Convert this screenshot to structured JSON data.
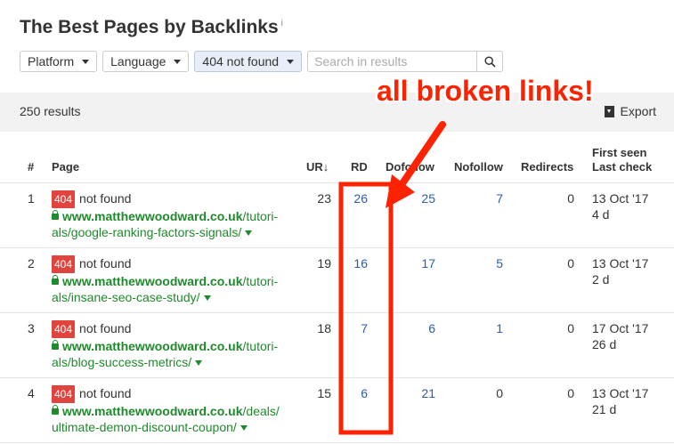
{
  "header": {
    "title": "The Best Pages by Backlinks",
    "info_mark": "i",
    "filters": {
      "platform": "Platform",
      "language": "Language",
      "status": "404 not found"
    },
    "search_placeholder": "Search in results"
  },
  "bar": {
    "results": "250 results",
    "export": "Export"
  },
  "columns": {
    "idx": "#",
    "page": "Page",
    "ur": "UR",
    "ur_sort": "↓",
    "rd": "RD",
    "dofollow": "Dofollow",
    "nofollow": "Nofollow",
    "redirects": "Redirects",
    "first_seen": "First seen",
    "last_check": "Last check"
  },
  "rows": [
    {
      "idx": "1",
      "badge": "404",
      "status": "not found",
      "domain": "www.matthewwoodward.co.uk",
      "path1": "/tutori-",
      "path2": "als/google-ranking-factors-signals/",
      "ur": "23",
      "rd": "26",
      "dofollow": "25",
      "nofollow": "7",
      "redirects": "0",
      "first_seen": "13 Oct '17",
      "last_check": "4 d"
    },
    {
      "idx": "2",
      "badge": "404",
      "status": "not found",
      "domain": "www.matthewwoodward.co.uk",
      "path1": "/tutori-",
      "path2": "als/insane-seo-case-study/",
      "ur": "19",
      "rd": "16",
      "dofollow": "17",
      "nofollow": "5",
      "redirects": "0",
      "first_seen": "13 Oct '17",
      "last_check": "2 d"
    },
    {
      "idx": "3",
      "badge": "404",
      "status": "not found",
      "domain": "www.matthewwoodward.co.uk",
      "path1": "/tutori-",
      "path2": "als/blog-success-metrics/",
      "ur": "18",
      "rd": "7",
      "dofollow": "6",
      "nofollow": "1",
      "redirects": "0",
      "first_seen": "17 Oct '17",
      "last_check": "26 d"
    },
    {
      "idx": "4",
      "badge": "404",
      "status": "not found",
      "domain": "www.matthewwoodward.co.uk",
      "path1": "/deals/",
      "path2": "ultimate-demon-discount-coupon/",
      "ur": "15",
      "rd": "6",
      "dofollow": "21",
      "nofollow": "0",
      "redirects": "0",
      "first_seen": "13 Oct '17",
      "last_check": "21 d"
    }
  ],
  "annotation": {
    "text": "all broken links!",
    "color": "#ff2200"
  },
  "colors": {
    "link_blue": "#2a5ea8",
    "url_green": "#1f8a2b",
    "badge_red": "#e0443e"
  }
}
